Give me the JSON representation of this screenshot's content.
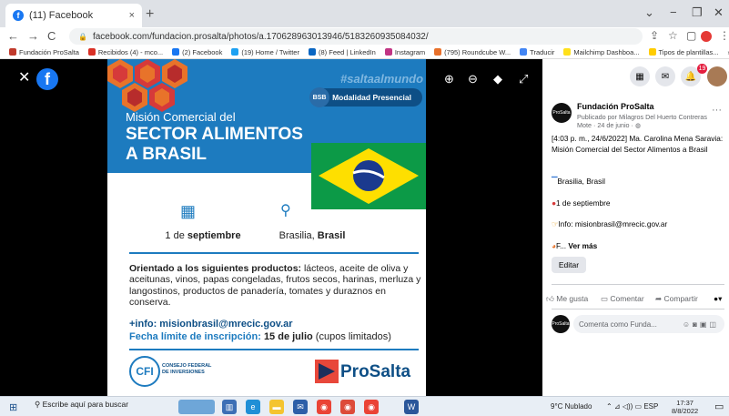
{
  "browser": {
    "tab_title": "(11) Facebook",
    "tab_close": "×",
    "new_tab": "+",
    "minimize": "−",
    "restore": "❐",
    "close": "✕",
    "collapse": "⌄",
    "back": "←",
    "forward": "→",
    "reload": "C",
    "url": "facebook.com/fundacion.prosalta/photos/a.170628963013946/5183260935084032/",
    "bookmarks": [
      {
        "label": "Fundación ProSalta",
        "color": "#c0392b"
      },
      {
        "label": "Recibidos (4) - mco...",
        "color": "#d93025"
      },
      {
        "label": "(2) Facebook",
        "color": "#1877f2"
      },
      {
        "label": "(19) Home / Twitter",
        "color": "#1da1f2"
      },
      {
        "label": "(8) Feed | LinkedIn",
        "color": "#0a66c2"
      },
      {
        "label": "Instagram",
        "color": "#c13584"
      },
      {
        "label": "(795) Roundcube W...",
        "color": "#e8702a"
      },
      {
        "label": "Traducir",
        "color": "#4285f4"
      },
      {
        "label": "Mailchimp Dashboa...",
        "color": "#ffe01b"
      },
      {
        "label": "Tipos de plantillas...",
        "color": "#ffcc00"
      }
    ],
    "bookmarks_more": "»"
  },
  "viewer": {
    "close_icon": "✕",
    "fb_logo": "f"
  },
  "poster": {
    "hashtag": "#saltaalmundo",
    "modality": "Modalidad Presencial",
    "modality_badge": "BSB",
    "line1": "Misión Comercial del",
    "line2": "SECTOR ALIMENTOS",
    "line3": "A BRASIL",
    "date_pre": "1 de ",
    "date_bold": "septiembre",
    "city_pre": "Brasilia, ",
    "city_bold": "Brasil",
    "orient_bold": "Orientado a los siguientes productos:",
    "orient_text": " lácteos, aceite de oliva y aceitunas, vinos, papas congeladas, frutos secos, harinas, merluza y langostinos, productos de panadería, tomates y duraznos en conserva.",
    "info": "+info: misionbrasil@mrecic.gov.ar",
    "fecha_label": "Fecha límite de inscripción:",
    "fecha_date": "15 de julio",
    "fecha_note": "(cupos limitados)",
    "cfi": "CFI",
    "cfi_line1": "CONSEJO FEDERAL",
    "cfi_line2": "DE INVERSIONES",
    "prosalta": "ProSalta"
  },
  "side": {
    "notif_count": "19",
    "page_name": "Fundación ProSalta",
    "avatar_text": "ProSalta",
    "published_by": "Publicado por Milagros Del Huerto Contreras Mote",
    "published_date": "· 24 de junio ·",
    "post_text": "[4:03 p. m., 24/6/2022] Ma. Carolina Mena Saravia: Misión Comercial del Sector Alimentos a Brasil",
    "line_location": "Brasilia, Brasil",
    "line_date": "1 de septiembre",
    "line_info": "Info: misionbrasil@mrecic.gov.ar",
    "line_more_prefix": "F... ",
    "see_more": "Ver más",
    "edit": "Editar",
    "like": "Me gusta",
    "comment": "Comentar",
    "share": "Compartir",
    "comment_placeholder": "Comenta como Funda..."
  },
  "taskbar": {
    "search": "Escribe aquí para buscar",
    "weather": "9°C  Nublado",
    "lang": "ESP",
    "time": "17:37",
    "date": "8/8/2022"
  }
}
